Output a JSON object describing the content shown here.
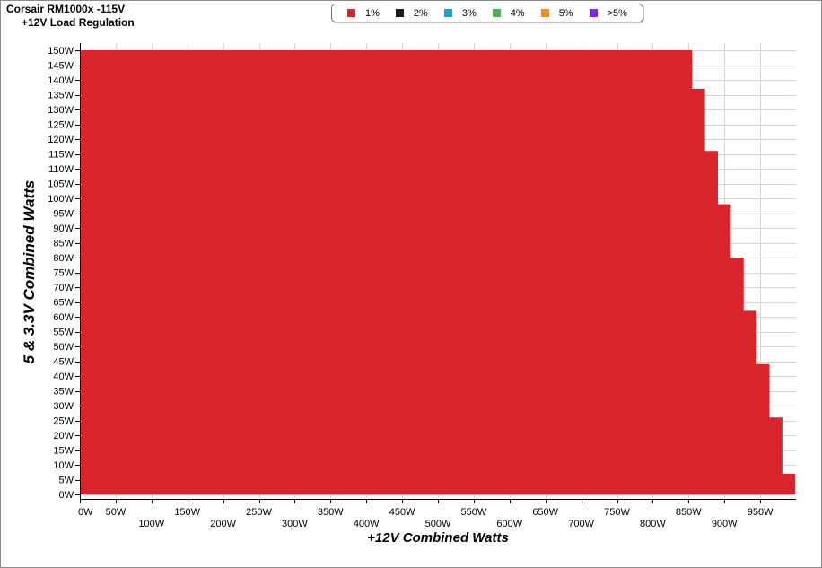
{
  "chart_data": {
    "type": "area",
    "title": "Corsair RM1000x -115V",
    "subtitle": "+12V Load Regulation",
    "xlabel": "+12V Combined Watts",
    "ylabel": "5 & 3.3V Combined Watts",
    "x_tick_labels_upper": [
      "0W",
      "50W",
      "150W",
      "250W",
      "350W",
      "450W",
      "550W",
      "650W",
      "750W",
      "850W",
      "950W"
    ],
    "x_tick_labels_lower": [
      "100W",
      "200W",
      "300W",
      "400W",
      "500W",
      "600W",
      "700W",
      "800W",
      "900W"
    ],
    "y_tick_labels": [
      "150W",
      "145W",
      "140W",
      "135W",
      "130W",
      "125W",
      "120W",
      "115W",
      "110W",
      "105W",
      "100W",
      "95W",
      "90W",
      "85W",
      "80W",
      "75W",
      "70W",
      "65W",
      "60W",
      "55W",
      "50W",
      "45W",
      "40W",
      "35W",
      "30W",
      "25W",
      "20W",
      "15W",
      "10W",
      "5W",
      "0W"
    ],
    "xlim": [
      0,
      1000
    ],
    "ylim": [
      0,
      150
    ],
    "grid": true,
    "legend_position": "top-center",
    "legend": [
      {
        "label": "1%",
        "color": "#d9242b"
      },
      {
        "label": "2%",
        "color": "#1a1a1a"
      },
      {
        "label": "3%",
        "color": "#1ea0d7"
      },
      {
        "label": "4%",
        "color": "#4caf50"
      },
      {
        "label": "5%",
        "color": "#f28c1e"
      },
      {
        "label": ">5%",
        "color": "#8e24d9"
      }
    ],
    "series": [
      {
        "name": "1%",
        "color": "#d9242b",
        "boundary": [
          {
            "x": 855,
            "y_max": 150
          },
          {
            "x": 873,
            "y_max": 137
          },
          {
            "x": 891,
            "y_max": 116
          },
          {
            "x": 909,
            "y_max": 98
          },
          {
            "x": 927,
            "y_max": 80
          },
          {
            "x": 945,
            "y_max": 62
          },
          {
            "x": 963,
            "y_max": 44
          },
          {
            "x": 981,
            "y_max": 26
          },
          {
            "x": 999,
            "y_max": 7
          }
        ]
      }
    ]
  }
}
